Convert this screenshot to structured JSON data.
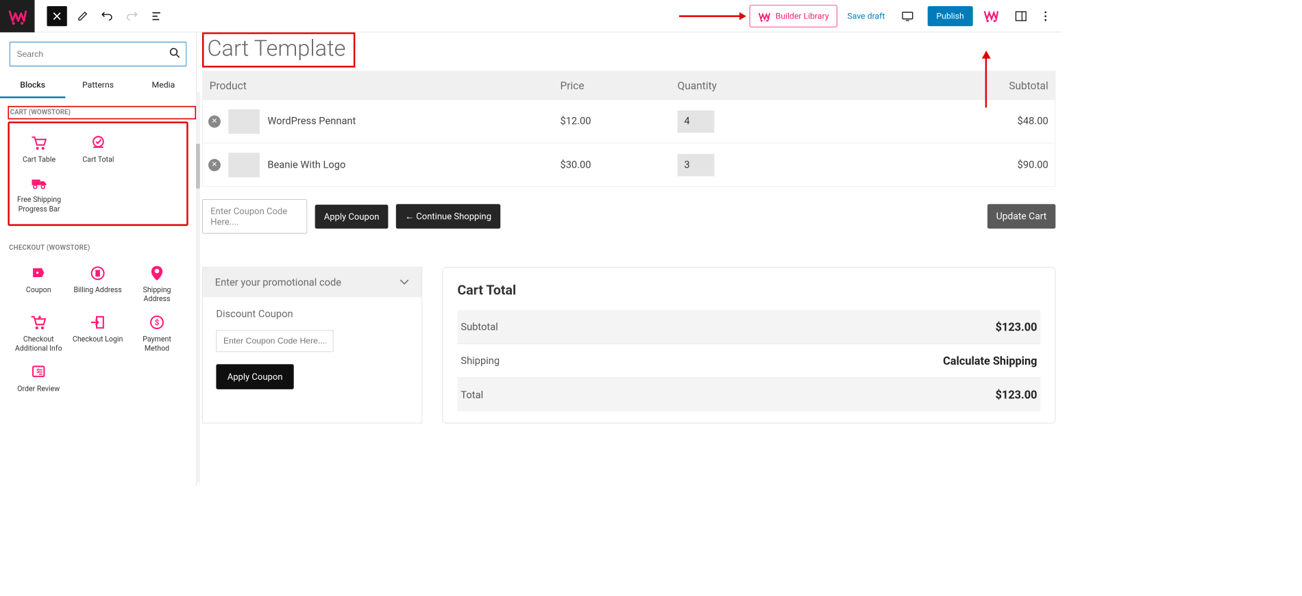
{
  "topbar": {
    "builder_library": "Builder Library",
    "save_draft": "Save draft",
    "publish": "Publish"
  },
  "sidebar": {
    "search_placeholder": "Search",
    "tabs": {
      "blocks": "Blocks",
      "patterns": "Patterns",
      "media": "Media"
    },
    "section_cart": "CART (WOWSTORE)",
    "section_checkout": "CHECKOUT (WOWSTORE)",
    "cart_blocks": {
      "cart_table": "Cart Table",
      "cart_total": "Cart Total",
      "free_shipping": "Free Shipping Progress Bar"
    },
    "checkout_blocks": {
      "coupon": "Coupon",
      "billing": "Billing Address",
      "shipping": "Shipping Address",
      "additional": "Checkout Additional Info",
      "login": "Checkout Login",
      "payment": "Payment Method",
      "order_review": "Order Review"
    }
  },
  "page": {
    "title": "Cart Template"
  },
  "cart": {
    "headers": {
      "product": "Product",
      "price": "Price",
      "quantity": "Quantity",
      "subtotal": "Subtotal"
    },
    "rows": [
      {
        "name": "WordPress Pennant",
        "price": "$12.00",
        "qty": "4",
        "subtotal": "$48.00"
      },
      {
        "name": "Beanie With Logo",
        "price": "$30.00",
        "qty": "3",
        "subtotal": "$90.00"
      }
    ],
    "coupon_placeholder": "Enter Coupon Code Here....",
    "apply_coupon": "Apply Coupon",
    "continue_shopping": "← Continue Shopping",
    "update_cart": "Update Cart"
  },
  "promo": {
    "header": "Enter your promotional code",
    "label": "Discount Coupon",
    "placeholder": "Enter Coupon Code Here.....",
    "apply": "Apply Coupon"
  },
  "totals": {
    "title": "Cart Total",
    "subtotal_label": "Subtotal",
    "subtotal_value": "$123.00",
    "shipping_label": "Shipping",
    "shipping_value": "Calculate Shipping",
    "total_label": "Total",
    "total_value": "$123.00"
  }
}
